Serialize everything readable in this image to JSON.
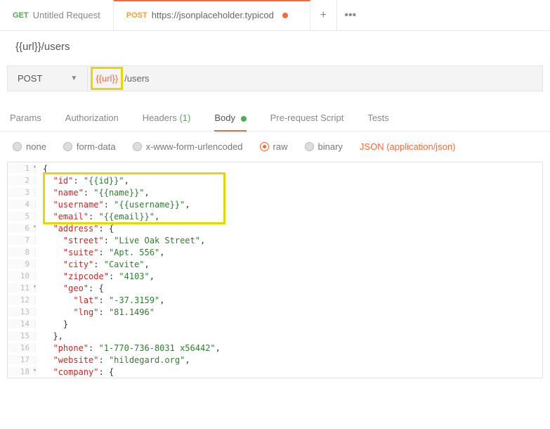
{
  "tabs": [
    {
      "method": "GET",
      "title": "Untitled Request",
      "dirty": false
    },
    {
      "method": "POST",
      "title": "https://jsonplaceholder.typicod",
      "dirty": true
    }
  ],
  "request_name": "{{url}}/users",
  "method_dd": "POST",
  "url_var": "{{url}}",
  "url_rest": "/users",
  "req_tabs": {
    "params": "Params",
    "auth": "Authorization",
    "headers": "Headers",
    "headers_count": "(1)",
    "body": "Body",
    "prescript": "Pre-request Script",
    "tests": "Tests"
  },
  "body_opts": {
    "none": "none",
    "formdata": "form-data",
    "urlencoded": "x-www-form-urlencoded",
    "raw": "raw",
    "binary": "binary",
    "content_type": "JSON (application/json)"
  },
  "code": [
    {
      "n": "1",
      "fold": "▾",
      "ind": 0,
      "t": [
        [
          "p",
          "{"
        ]
      ]
    },
    {
      "n": "2",
      "ind": 1,
      "t": [
        [
          "k",
          "\"id\""
        ],
        [
          "p",
          ": "
        ],
        [
          "s",
          "\"{{id}}\""
        ],
        [
          "p",
          ","
        ]
      ]
    },
    {
      "n": "3",
      "ind": 1,
      "t": [
        [
          "k",
          "\"name\""
        ],
        [
          "p",
          ": "
        ],
        [
          "s",
          "\"{{name}}\""
        ],
        [
          "p",
          ","
        ]
      ]
    },
    {
      "n": "4",
      "ind": 1,
      "t": [
        [
          "k",
          "\"username\""
        ],
        [
          "p",
          ": "
        ],
        [
          "s",
          "\"{{username}}\""
        ],
        [
          "p",
          ","
        ]
      ]
    },
    {
      "n": "5",
      "ind": 1,
      "t": [
        [
          "k",
          "\"email\""
        ],
        [
          "p",
          ": "
        ],
        [
          "s",
          "\"{{email}}\""
        ],
        [
          "p",
          ","
        ]
      ]
    },
    {
      "n": "6",
      "fold": "▾",
      "ind": 1,
      "t": [
        [
          "k",
          "\"address\""
        ],
        [
          "p",
          ": {"
        ]
      ]
    },
    {
      "n": "7",
      "ind": 2,
      "t": [
        [
          "k",
          "\"street\""
        ],
        [
          "p",
          ": "
        ],
        [
          "s",
          "\"Live Oak Street\""
        ],
        [
          "p",
          ","
        ]
      ]
    },
    {
      "n": "8",
      "ind": 2,
      "t": [
        [
          "k",
          "\"suite\""
        ],
        [
          "p",
          ": "
        ],
        [
          "s",
          "\"Apt. 556\""
        ],
        [
          "p",
          ","
        ]
      ]
    },
    {
      "n": "9",
      "ind": 2,
      "t": [
        [
          "k",
          "\"city\""
        ],
        [
          "p",
          ": "
        ],
        [
          "s",
          "\"Cavite\""
        ],
        [
          "p",
          ","
        ]
      ]
    },
    {
      "n": "10",
      "ind": 2,
      "t": [
        [
          "k",
          "\"zipcode\""
        ],
        [
          "p",
          ": "
        ],
        [
          "s",
          "\"4103\""
        ],
        [
          "p",
          ","
        ]
      ]
    },
    {
      "n": "11",
      "fold": "▾",
      "ind": 2,
      "t": [
        [
          "k",
          "\"geo\""
        ],
        [
          "p",
          ": {"
        ]
      ]
    },
    {
      "n": "12",
      "ind": 3,
      "t": [
        [
          "k",
          "\"lat\""
        ],
        [
          "p",
          ": "
        ],
        [
          "s",
          "\"-37.3159\""
        ],
        [
          "p",
          ","
        ]
      ]
    },
    {
      "n": "13",
      "ind": 3,
      "t": [
        [
          "k",
          "\"lng\""
        ],
        [
          "p",
          ": "
        ],
        [
          "s",
          "\"81.1496\""
        ]
      ]
    },
    {
      "n": "14",
      "ind": 2,
      "t": [
        [
          "p",
          "}"
        ]
      ]
    },
    {
      "n": "15",
      "ind": 1,
      "t": [
        [
          "p",
          "},"
        ]
      ]
    },
    {
      "n": "16",
      "ind": 1,
      "t": [
        [
          "k",
          "\"phone\""
        ],
        [
          "p",
          ": "
        ],
        [
          "s",
          "\"1-770-736-8031 x56442\""
        ],
        [
          "p",
          ","
        ]
      ]
    },
    {
      "n": "17",
      "ind": 1,
      "t": [
        [
          "k",
          "\"website\""
        ],
        [
          "p",
          ": "
        ],
        [
          "s",
          "\"hildegard.org\""
        ],
        [
          "p",
          ","
        ]
      ]
    },
    {
      "n": "18",
      "fold": "▾",
      "ind": 1,
      "t": [
        [
          "k",
          "\"company\""
        ],
        [
          "p",
          ": {"
        ]
      ]
    }
  ]
}
